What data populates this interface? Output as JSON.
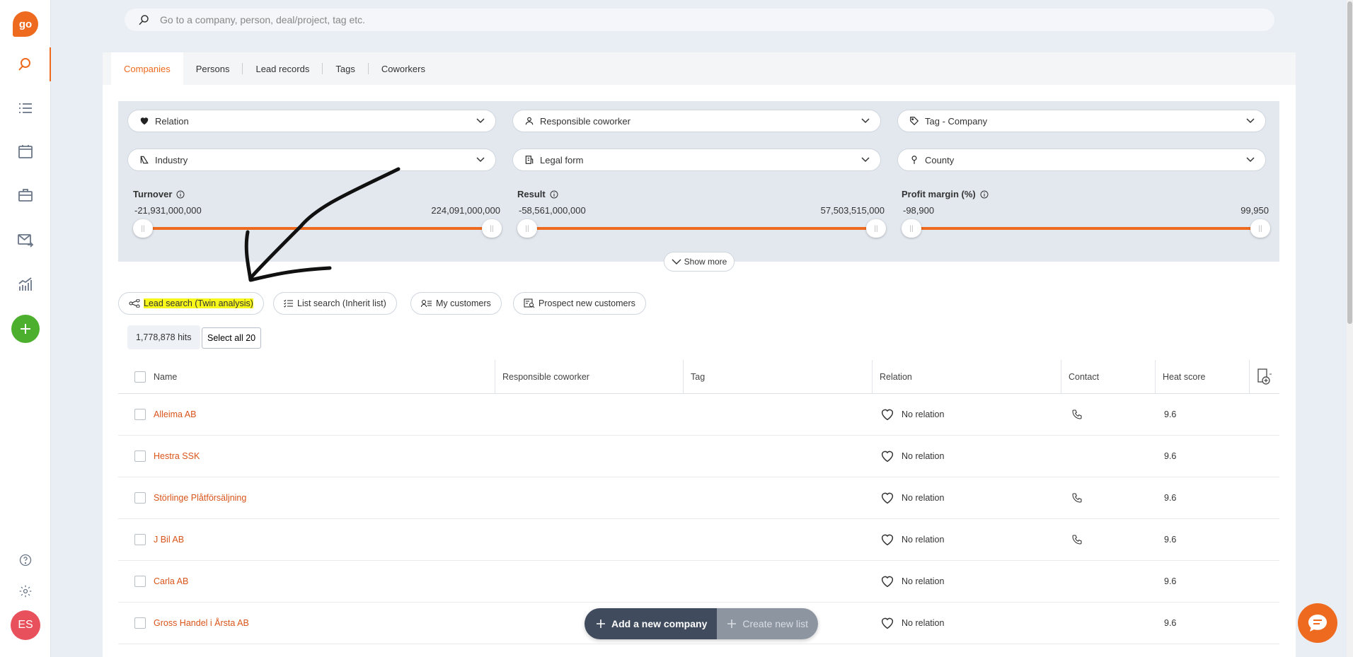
{
  "sidebar": {
    "logo": "go",
    "icons": [
      "search-icon",
      "list-icon",
      "calendar-icon",
      "briefcase-icon",
      "mail-icon",
      "chart-icon"
    ],
    "add_icon": "plus-icon",
    "bottom_icons": [
      "help-icon",
      "gear-icon"
    ],
    "avatar": "ES"
  },
  "search": {
    "placeholder": "Go to a company, person, deal/project, tag etc."
  },
  "tabs": [
    "Companies",
    "Persons",
    "Lead records",
    "Tags",
    "Coworkers"
  ],
  "filters": {
    "relation": "Relation",
    "responsible": "Responsible coworker",
    "tag": "Tag - Company",
    "industry": "Industry",
    "legal_form": "Legal form",
    "county": "County"
  },
  "ranges": {
    "turnover": {
      "label": "Turnover",
      "min": "-21,931,000,000",
      "max": "224,091,000,000"
    },
    "result": {
      "label": "Result",
      "min": "-58,561,000,000",
      "max": "57,503,515,000"
    },
    "profit": {
      "label": "Profit margin (%)",
      "min": "-98,900",
      "max": "99,950"
    }
  },
  "show_more": "Show more",
  "quick_actions": {
    "lead_search": "Lead search (Twin analysis)",
    "list_search": "List search (Inherit list)",
    "my_customers": "My customers",
    "prospect": "Prospect new customers"
  },
  "hits": "1,778,878 hits",
  "select_all": "Select all 20",
  "table": {
    "headers": {
      "name": "Name",
      "responsible": "Responsible coworker",
      "tag": "Tag",
      "relation": "Relation",
      "contact": "Contact",
      "heat": "Heat score"
    },
    "rows": [
      {
        "name": "Alleima AB",
        "relation": "No relation",
        "phone": true,
        "heat": "9.6"
      },
      {
        "name": "Hestra SSK",
        "relation": "No relation",
        "phone": false,
        "heat": "9.6"
      },
      {
        "name": "Störlinge Plåtförsäljning",
        "relation": "No relation",
        "phone": true,
        "heat": "9.6"
      },
      {
        "name": "J Bil AB",
        "relation": "No relation",
        "phone": true,
        "heat": "9.6"
      },
      {
        "name": "Carla AB",
        "relation": "No relation",
        "phone": false,
        "heat": "9.6"
      },
      {
        "name": "Gross Handel i Årsta AB",
        "relation": "No relation",
        "phone": false,
        "heat": "9.6"
      }
    ]
  },
  "actions": {
    "add_company": "Add a new company",
    "create_list": "Create new list"
  },
  "colors": {
    "accent": "#ee6a1f",
    "add": "#4caf2e",
    "avatar": "#e8505b",
    "highlight": "#f7f71a"
  }
}
